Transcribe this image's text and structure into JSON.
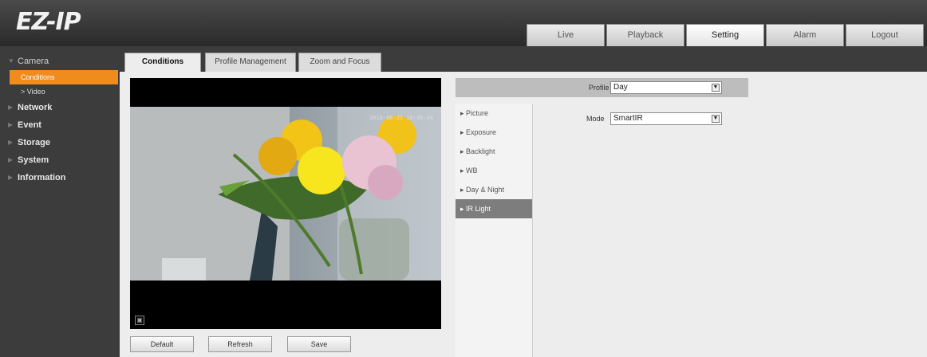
{
  "logo": "EZ-IP",
  "nav": [
    "Live",
    "Playback",
    "Setting",
    "Alarm",
    "Logout"
  ],
  "sidebar": {
    "camera": "Camera",
    "camera_sub": [
      "Conditions",
      "Video"
    ],
    "items": [
      "Network",
      "Event",
      "Storage",
      "System",
      "Information"
    ]
  },
  "subtabs": [
    "Conditions",
    "Profile Management",
    "Zoom and Focus"
  ],
  "video": {
    "timestamp": "2018-06-25 10:06:44"
  },
  "buttons": [
    "Default",
    "Refresh",
    "Save"
  ],
  "profile": {
    "label": "Profile",
    "value": "Day"
  },
  "mode": {
    "label": "Mode",
    "value": "SmartIR"
  },
  "menu": [
    "Picture",
    "Exposure",
    "Backlight",
    "WB",
    "Day & Night",
    "IR Light"
  ],
  "colors": {
    "accent": "#f08b1e",
    "menu_active": "#7d7d7d"
  }
}
